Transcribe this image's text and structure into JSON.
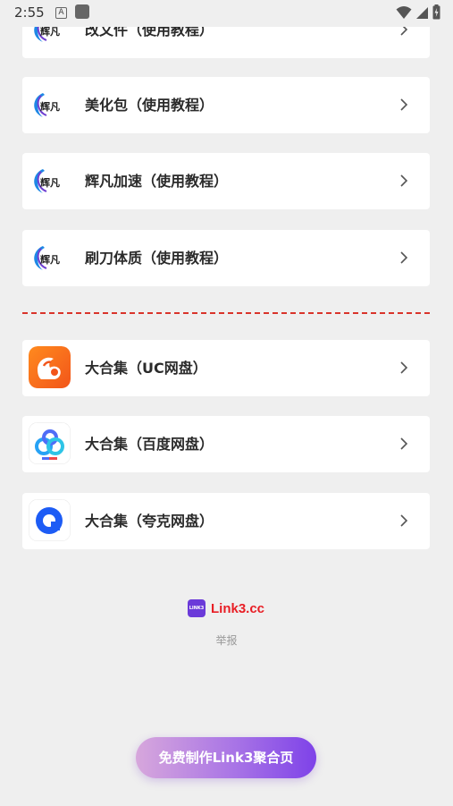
{
  "status_bar": {
    "time": "2:55",
    "notification_letter": "A"
  },
  "tutorial_cards": [
    {
      "label": "改文件（使用教程）",
      "logo_text": "辉凡"
    },
    {
      "label": "美化包（使用教程）",
      "logo_text": "辉凡"
    },
    {
      "label": "辉凡加速（使用教程）",
      "logo_text": "辉凡"
    },
    {
      "label": "刷刀体质（使用教程）",
      "logo_text": "辉凡"
    }
  ],
  "collection_cards": [
    {
      "label": "大合集（UC网盘）",
      "icon": "uc-drive-icon"
    },
    {
      "label": "大合集（百度网盘）",
      "icon": "baidu-netdisk-icon"
    },
    {
      "label": "大合集（夸克网盘）",
      "icon": "quark-drive-icon"
    }
  ],
  "footer": {
    "brand_mark": "LINK3",
    "brand_name": "Link3.cc",
    "report": "举报",
    "cta": "免费制作Link3聚合页"
  },
  "colors": {
    "background": "#efefef",
    "card": "#ffffff",
    "divider": "#d9342b",
    "brand_red": "#e81e25",
    "cta_start": "#d7a7dc",
    "cta_end": "#7e42e8"
  }
}
